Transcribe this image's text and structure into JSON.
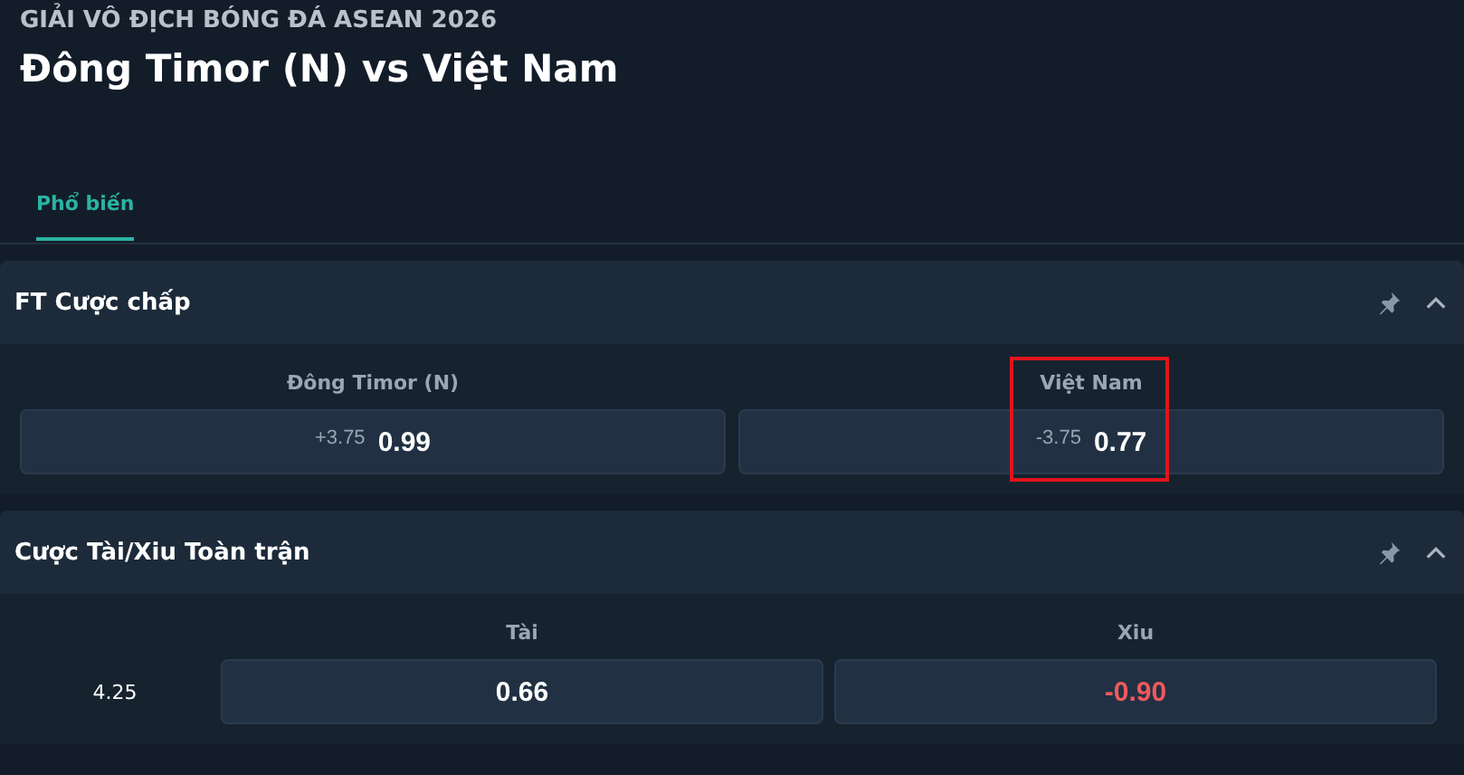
{
  "league": "GIẢI VÔ ĐỊCH BÓNG ĐÁ ASEAN 2026",
  "match_title": "Đông Timor (N) vs Việt Nam",
  "tabs": [
    {
      "label": "Phổ biến",
      "selected": true
    }
  ],
  "markets": [
    {
      "kind": "handicap",
      "title": "FT Cược chấp",
      "expanded": true,
      "columns": [
        "Đông Timor (N)",
        "Việt Nam"
      ],
      "rows": [
        {
          "options": [
            {
              "line": "+3.75",
              "price": "0.99",
              "negative": false,
              "highlighted": false
            },
            {
              "line": "-3.75",
              "price": "0.77",
              "negative": false,
              "highlighted": true
            }
          ]
        }
      ]
    },
    {
      "kind": "total",
      "title": "Cược Tài/Xiu Toàn trận",
      "expanded": true,
      "columns": [
        "Tài",
        "Xiu"
      ],
      "rows": [
        {
          "line": "4.25",
          "options": [
            {
              "price": "0.66",
              "negative": false
            },
            {
              "price": "-0.90",
              "negative": true
            }
          ]
        }
      ]
    }
  ]
}
